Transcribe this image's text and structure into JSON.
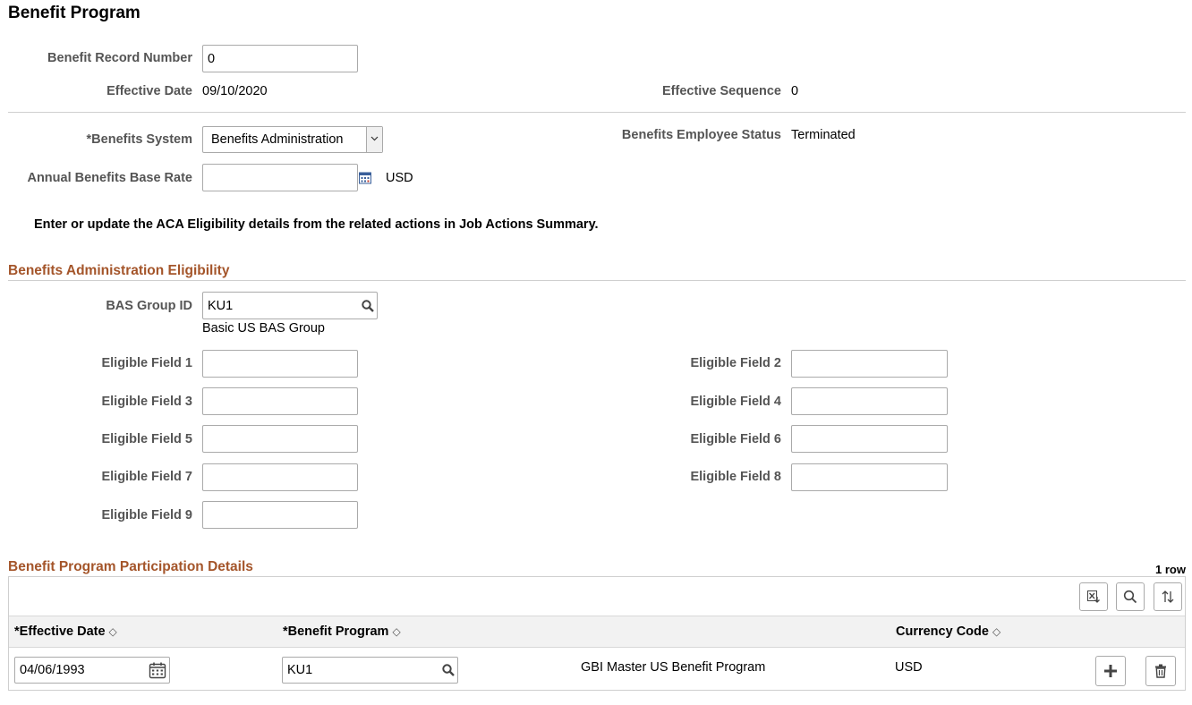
{
  "page": {
    "title": "Benefit Program"
  },
  "record": {
    "record_number_label": "Benefit Record Number",
    "record_number_value": "0",
    "effective_date_label": "Effective Date",
    "effective_date_value": "09/10/2020",
    "effective_sequence_label": "Effective Sequence",
    "effective_sequence_value": "0"
  },
  "system": {
    "benefits_system_label": "*Benefits System",
    "benefits_system_value": "Benefits Administration",
    "employee_status_label": "Benefits Employee Status",
    "employee_status_value": "Terminated",
    "base_rate_label": "Annual Benefits Base Rate",
    "base_rate_value": "",
    "currency": "USD",
    "note": "Enter or update the ACA Eligibility details from the related actions in Job Actions Summary."
  },
  "eligibility": {
    "section_title": "Benefits Administration Eligibility",
    "bas_group_label": "BAS Group ID",
    "bas_group_value": "KU1",
    "bas_group_desc": "Basic US BAS Group",
    "fields": [
      {
        "label": "Eligible Field 1",
        "value": ""
      },
      {
        "label": "Eligible Field 2",
        "value": ""
      },
      {
        "label": "Eligible Field 3",
        "value": ""
      },
      {
        "label": "Eligible Field 4",
        "value": ""
      },
      {
        "label": "Eligible Field 5",
        "value": ""
      },
      {
        "label": "Eligible Field 6",
        "value": ""
      },
      {
        "label": "Eligible Field 7",
        "value": ""
      },
      {
        "label": "Eligible Field 8",
        "value": ""
      },
      {
        "label": "Eligible Field 9",
        "value": ""
      }
    ]
  },
  "participation": {
    "section_title": "Benefit Program Participation Details",
    "row_count": "1 row",
    "columns": {
      "effective_date": "*Effective Date",
      "benefit_program": "*Benefit Program",
      "currency_code": "Currency Code"
    },
    "rows": [
      {
        "effective_date": "04/06/1993",
        "benefit_program": "KU1",
        "program_desc": "GBI Master US Benefit Program",
        "currency_code": "USD"
      }
    ]
  },
  "colors": {
    "section_title": "#a4552a",
    "label": "#555555",
    "border": "#aaaaaa"
  },
  "icons": [
    "lookup-icon",
    "calculator-icon",
    "calendar-icon",
    "export-icon",
    "find-icon",
    "sort-icon",
    "add-row-icon",
    "delete-row-icon",
    "chevron-down-icon",
    "sort-indicator-icon"
  ]
}
